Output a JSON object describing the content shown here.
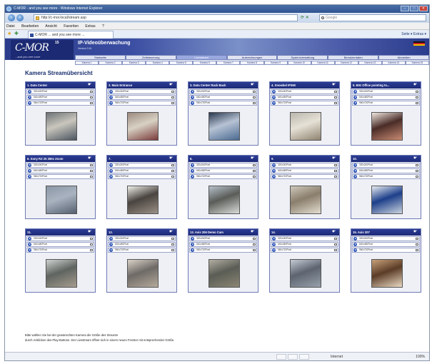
{
  "browser": {
    "title": "C-MOR - and you see more - Windows Internet Explorer",
    "url": "http://c-mor.local/stream.asp",
    "search_placeholder": "Google",
    "menu": [
      "Datei",
      "Bearbeiten",
      "Ansicht",
      "Favoriten",
      "Extras",
      "?"
    ],
    "tab_label": "C-MOR ... and you see more ...",
    "tools": "Seite  ▾   Extras  ▾",
    "status_zone": "Internet",
    "status_zoom": "100%"
  },
  "app": {
    "logo_text": "C-MOR",
    "logo_mark": "15",
    "claim": "...and you see more",
    "product": "IP-Videoüberwachung",
    "version": "Version 3.91",
    "main_nav": [
      "Startseite",
      "Zeitsteuerung",
      "Livestream",
      "Aufzeichnungen",
      "Systemverwaltung",
      "Benutzerdaten",
      "Abmelden"
    ],
    "active_nav": 2,
    "camera_nav": [
      "Kamera 1",
      "Kamera 2",
      "Kamera 3",
      "Kamera 4",
      "Kamera 5",
      "Kamera 6",
      "Kamera 7",
      "Kamera 8",
      "Kamera 9",
      "Kamera 10",
      "Kamera 11",
      "Kamera 12",
      "Kamera 13",
      "Kamera 14",
      "Kamera 15"
    ],
    "page_title": "Kamera Streamübersicht",
    "footnote_1": "Bitte wählen Sie bei der gewünschten Kamera die Größe des Streams",
    "footnote_2": "durch Anklicken des Play-Buttons. Der Livestream öffnet sich in einem neuen Fenster mit entsprechender Größe."
  },
  "cameras": [
    {
      "name": "1. Data Center",
      "streams": [
        "320x240Pixel",
        "640x480Pixel",
        "960x720Pixel"
      ],
      "thumb": [
        "#6e7378",
        "#c9c6bd",
        "#4b5560"
      ]
    },
    {
      "name": "2. Main Entrance",
      "streams": [
        "320x240Pixel",
        "640x480Pixel",
        "960x720Pixel"
      ],
      "thumb": [
        "#9c8a7f",
        "#d8d2c4",
        "#7a3b3b"
      ]
    },
    {
      "name": "3. Data Center Rack Back",
      "streams": [
        "320x240Pixel",
        "640x480Pixel",
        "960x720Pixel"
      ],
      "thumb": [
        "#2a3850",
        "#b7c3d4",
        "#4a6a92"
      ]
    },
    {
      "name": "4. Snowbel IP360",
      "streams": [
        "320x240Pixel",
        "640x480Pixel",
        "960x720Pixel"
      ],
      "thumb": [
        "#b9b6ad",
        "#e6e1d6",
        "#8f8370"
      ]
    },
    {
      "name": "5. BIG Office pointing to...",
      "streams": [
        "320x240Pixel",
        "640x480Pixel",
        "960x720Pixel"
      ],
      "thumb": [
        "#efe7df",
        "#4a2c28",
        "#c98b73"
      ]
    },
    {
      "name": "6. Sony RZ 25 360x Zoom",
      "streams": [
        "320x240Pixel",
        "640x480Pixel",
        "960x720Pixel"
      ],
      "thumb": [
        "#8b97a6",
        "#a9b3c0",
        "#556070"
      ]
    },
    {
      "name": "7.",
      "streams": [
        "320x240Pixel",
        "640x480Pixel",
        "960x720Pixel"
      ],
      "thumb": [
        "#f0efea",
        "#4a4440",
        "#9a9187"
      ]
    },
    {
      "name": "8.",
      "streams": [
        "320x240Pixel",
        "640x480Pixel",
        "960x720Pixel"
      ],
      "thumb": [
        "#b7c1cb",
        "#5a5c58",
        "#d9dcd8"
      ]
    },
    {
      "name": "9.",
      "streams": [
        "320x240Pixel",
        "640x480Pixel",
        "960x720Pixel"
      ],
      "thumb": [
        "#cfc8bb",
        "#8a7e6c",
        "#e4ded1"
      ]
    },
    {
      "name": "10.",
      "streams": [
        "320x240Pixel",
        "640x480Pixel",
        "960x720Pixel"
      ],
      "thumb": [
        "#e8ecf1",
        "#1d3f8a",
        "#c9d3de"
      ]
    },
    {
      "name": "11.",
      "streams": [
        "320x240Pixel",
        "640x480Pixel",
        "960x720Pixel"
      ],
      "thumb": [
        "#cfd2d0",
        "#5f6460",
        "#a59c8f"
      ]
    },
    {
      "name": "12.",
      "streams": [
        "320x240Pixel",
        "640x480Pixel",
        "960x720Pixel"
      ],
      "thumb": [
        "#d9d2c8",
        "#6e6a66",
        "#b5aa9c"
      ]
    },
    {
      "name": "13. Axis 206 Demo Cam",
      "streams": [
        "320x240Pixel",
        "640x480Pixel",
        "960x720Pixel"
      ],
      "thumb": [
        "#b3aea3",
        "#5a5d55",
        "#8b8574"
      ]
    },
    {
      "name": "14.",
      "streams": [
        "320x240Pixel",
        "640x480Pixel",
        "960x720Pixel"
      ],
      "thumb": [
        "#c4cbd4",
        "#5d6470",
        "#97a0ab"
      ]
    },
    {
      "name": "15. Axis 207",
      "streams": [
        "320x240Pixel",
        "640x480Pixel",
        "960x720Pixel"
      ],
      "thumb": [
        "#c7a27b",
        "#5b3c27",
        "#ead9c2"
      ]
    }
  ]
}
